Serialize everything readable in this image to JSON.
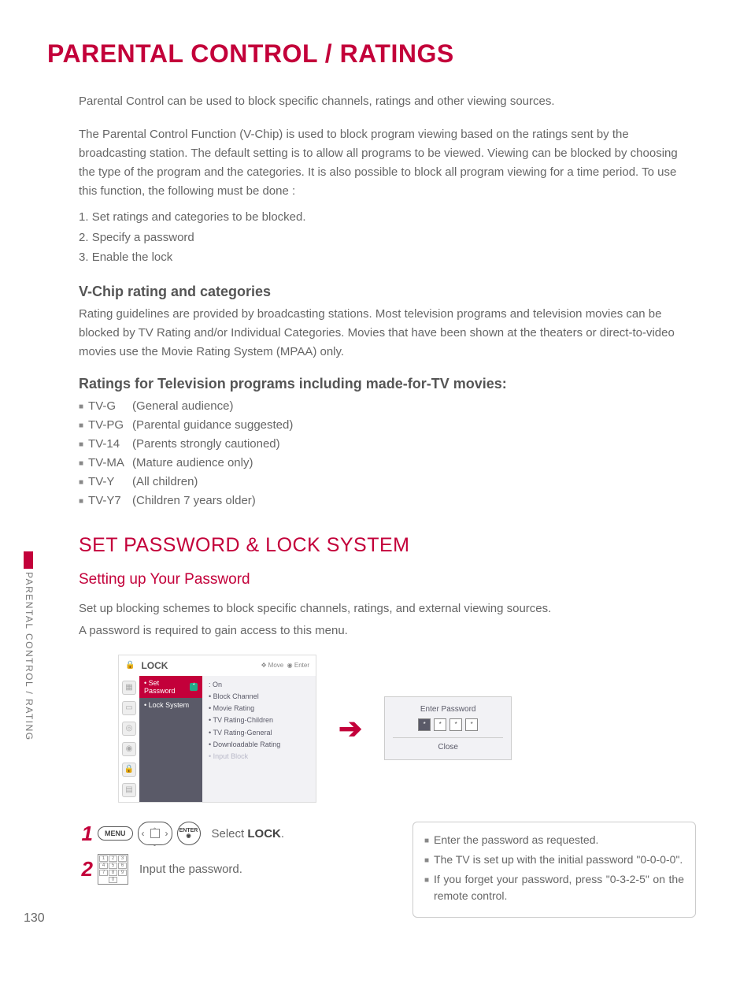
{
  "title": "PARENTAL CONTROL / RATINGS",
  "intro": "Parental Control can be used to block specific channels, ratings and other viewing sources.",
  "desc": "The Parental Control Function (V-Chip) is used to block program viewing based on the ratings sent by the broadcasting station. The default setting is to allow all programs to be viewed. Viewing can be blocked by choosing the type of the program and the categories. It is also possible to block all program viewing for a time period. To use this function, the following must be done :",
  "steps": [
    "Set ratings and categories to be blocked.",
    "Specify a password",
    "Enable the lock"
  ],
  "vchip_head": "V-Chip rating and categories",
  "vchip_text": "Rating guidelines are provided by broadcasting stations. Most television programs and television movies can be blocked by TV Rating and/or Individual Categories. Movies that have been shown at the theaters or direct-to-video movies use the Movie Rating System (MPAA) only.",
  "tv_head": "Ratings for Television programs including made-for-TV movies:",
  "tv_ratings": [
    {
      "code": "TV-G",
      "desc": "(General audience)"
    },
    {
      "code": "TV-PG",
      "desc": "(Parental guidance suggested)"
    },
    {
      "code": "TV-14",
      "desc": "(Parents strongly cautioned)"
    },
    {
      "code": "TV-MA",
      "desc": "(Mature audience only)"
    },
    {
      "code": "TV-Y",
      "desc": "(All children)"
    },
    {
      "code": "TV-Y7",
      "desc": "(Children 7 years older)"
    }
  ],
  "section2": "SET PASSWORD & LOCK SYSTEM",
  "sub2": "Setting up Your Password",
  "sub2_text1": "Set up blocking schemes to block specific channels, ratings, and external viewing sources.",
  "sub2_text2": "A password is required to gain access to this menu.",
  "side_label": "PARENTAL CONTROL / RATING",
  "osd": {
    "title": "LOCK",
    "hint_move": "Move",
    "hint_enter": "Enter",
    "menu_items": [
      "Set Password",
      "Lock System"
    ],
    "selected": "Set Password",
    "content": {
      "lock_state": ": On",
      "lines": [
        "Block Channel",
        "Movie Rating",
        "TV Rating-Children",
        "TV Rating-General",
        "Downloadable Rating"
      ],
      "faded": "Input Block"
    }
  },
  "pw_dialog": {
    "title": "Enter Password",
    "close": "Close"
  },
  "instr": {
    "step1_label": "MENU",
    "step1_enter": "ENTER",
    "step1_text_a": "Select ",
    "step1_text_b": "LOCK",
    "step1_text_c": ".",
    "step2_text": "Input the password.",
    "notes": [
      "Enter the password as requested.",
      "The TV is set up with the initial password \"0-0-0-0\".",
      "If you forget your password, press \"0-3-2-5\" on the remote control."
    ]
  },
  "page_number": "130"
}
